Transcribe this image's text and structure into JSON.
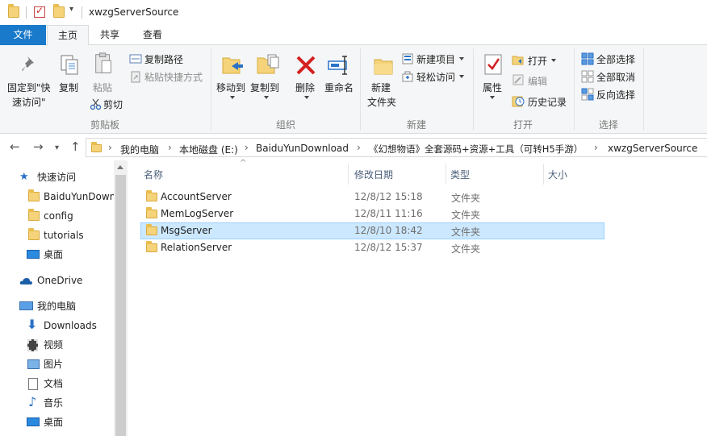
{
  "window": {
    "title": "xwzgServerSource"
  },
  "tabs": [
    {
      "label": "文件"
    },
    {
      "label": "主页"
    },
    {
      "label": "共享"
    },
    {
      "label": "查看"
    }
  ],
  "ribbon": {
    "clipboard": {
      "label": "剪贴板",
      "pin_label_1": "固定到\"快",
      "pin_label_2": "速访问\"",
      "copy": "复制",
      "paste": "粘贴",
      "copy_path": "复制路径",
      "paste_shortcut": "粘贴快捷方式",
      "cut": "剪切"
    },
    "organize": {
      "label": "组织",
      "move_to": "移动到",
      "copy_to": "复制到",
      "delete": "删除",
      "rename": "重命名"
    },
    "new": {
      "label": "新建",
      "new_folder_1": "新建",
      "new_folder_2": "文件夹",
      "new_item": "新建项目",
      "easy_access": "轻松访问"
    },
    "open": {
      "label": "打开",
      "properties": "属性",
      "open": "打开",
      "edit": "编辑",
      "history": "历史记录"
    },
    "select": {
      "label": "选择",
      "select_all": "全部选择",
      "select_none": "全部取消",
      "invert": "反向选择"
    }
  },
  "address": {
    "crumbs": [
      "我的电脑",
      "本地磁盘 (E:)",
      "BaiduYunDownload",
      "《幻想物语》全套源码+资源+工具（可转H5手游）",
      "xwzgServerSource"
    ]
  },
  "nav": {
    "quick_access": "快速访问",
    "items": [
      {
        "label": "BaiduYunDown"
      },
      {
        "label": "config"
      },
      {
        "label": "tutorials"
      },
      {
        "label": "桌面"
      }
    ],
    "onedrive": "OneDrive",
    "this_pc": "我的电脑",
    "pc_items": [
      {
        "label": "Downloads"
      },
      {
        "label": "视频"
      },
      {
        "label": "图片"
      },
      {
        "label": "文档"
      },
      {
        "label": "音乐"
      },
      {
        "label": "桌面"
      }
    ]
  },
  "columns": {
    "name": "名称",
    "modified": "修改日期",
    "type": "类型",
    "size": "大小"
  },
  "files": [
    {
      "name": "AccountServer",
      "modified": "12/8/12 15:18",
      "type": "文件夹"
    },
    {
      "name": "MemLogServer",
      "modified": "12/8/11 11:16",
      "type": "文件夹"
    },
    {
      "name": "MsgServer",
      "modified": "12/8/10 18:42",
      "type": "文件夹"
    },
    {
      "name": "RelationServer",
      "modified": "12/8/12 15:37",
      "type": "文件夹"
    }
  ],
  "colors": {
    "accent": "#1979ca",
    "selection": "#cce8ff",
    "folder": "#f5d37a"
  }
}
